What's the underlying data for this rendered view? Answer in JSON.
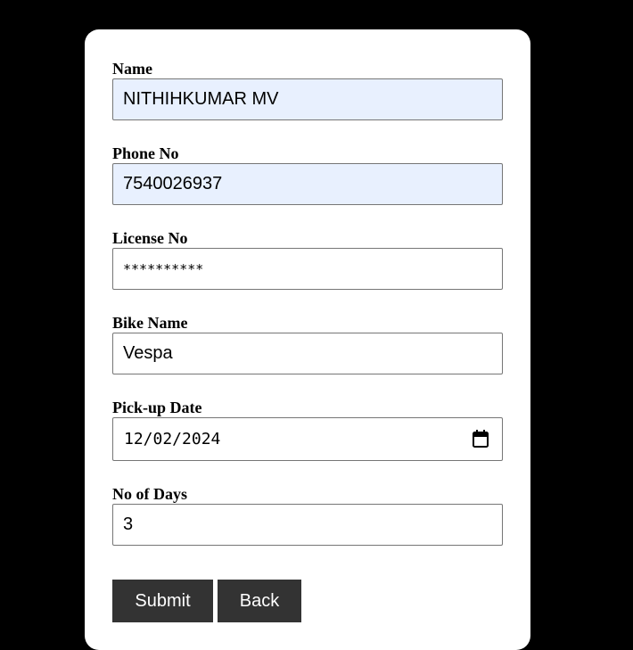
{
  "form": {
    "name": {
      "label": "Name",
      "value": "NITHIHKUMAR MV"
    },
    "phone": {
      "label": "Phone No",
      "value": "7540026937"
    },
    "license": {
      "label": "License No",
      "value": "**********"
    },
    "bike": {
      "label": "Bike Name",
      "value": "Vespa"
    },
    "pickup": {
      "label": "Pick-up Date",
      "value": "12/02/2024",
      "icon": "calendar-icon"
    },
    "days": {
      "label": "No of Days",
      "value": "3"
    }
  },
  "buttons": {
    "submit_label": "Submit",
    "back_label": "Back"
  },
  "colors": {
    "background": "#000000",
    "card": "#ffffff",
    "autofill": "#e8f0fe",
    "button": "#333333",
    "button_text": "#ffffff"
  }
}
